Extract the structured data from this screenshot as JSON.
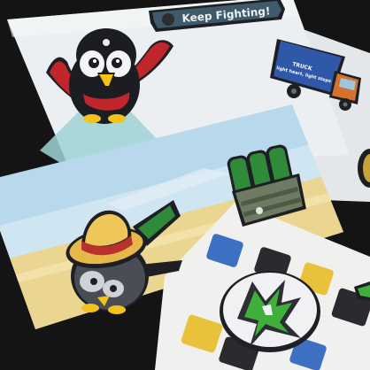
{
  "photo": {
    "subject": "enamel-pins-on-cards",
    "colors": {
      "background": "#141414",
      "card_light": "#e9edf0",
      "sky_blue": "#a9cfe6",
      "sand": "#e8d08a",
      "penguin_black": "#1c1d22",
      "scarf_red": "#c0262c",
      "beak_yellow": "#f3c21b",
      "hat_yellow": "#e6b84a",
      "truck_blue": "#2f58a8",
      "truck_orange": "#d5712c",
      "bottle_green": "#2f8a3a",
      "tile_blue": "#3d6fc2",
      "tile_yellow": "#e7c23a"
    }
  },
  "pins": {
    "banner_text": "Keep Fighting!",
    "truck_text": "light heart, light steps",
    "truck_brand": "TRUCK"
  }
}
